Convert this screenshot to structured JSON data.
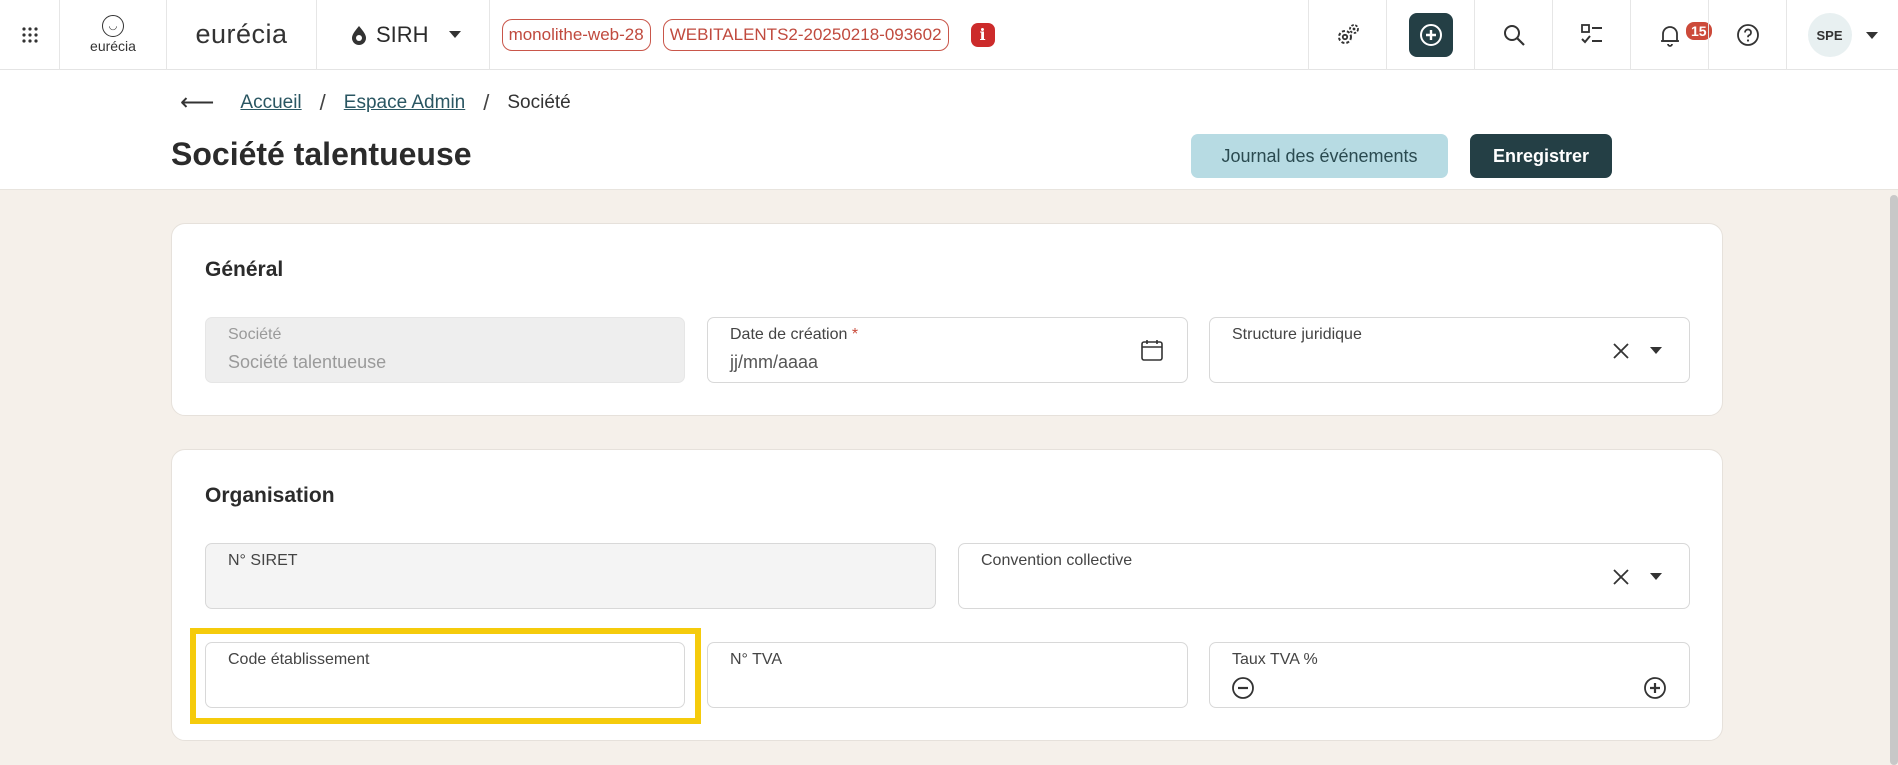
{
  "topbar": {
    "logo_small_text": "eurécia",
    "logo_big_text": "eurécia",
    "module_label": "SIRH",
    "env_tags": [
      "monolithe-web-28",
      "WEBITALENTS2-20250218-093602"
    ],
    "info_badge": "i",
    "notification_count": "15",
    "avatar_initials": "SPE"
  },
  "breadcrumb": {
    "back_symbol": "⟵",
    "items": [
      "Accueil",
      "Espace Admin",
      "Société"
    ]
  },
  "page": {
    "title": "Société talentueuse",
    "journal_button": "Journal des événements",
    "save_button": "Enregistrer"
  },
  "general": {
    "title": "Général",
    "societe_label": "Société",
    "societe_value": "Société talentueuse",
    "date_label": "Date de création",
    "date_required": "*",
    "date_placeholder": "jj/mm/aaaa",
    "structure_label": "Structure juridique"
  },
  "organisation": {
    "title": "Organisation",
    "siret_label": "N° SIRET",
    "convention_label": "Convention collective",
    "code_label": "Code établissement",
    "tva_label": "N° TVA",
    "taux_label": "Taux TVA %"
  },
  "colors": {
    "primary": "#243f45",
    "accent_light": "#b7dbe3",
    "env_tag": "#c04a3e",
    "highlight": "#f5cb0c",
    "background": "#f5f0ea"
  }
}
